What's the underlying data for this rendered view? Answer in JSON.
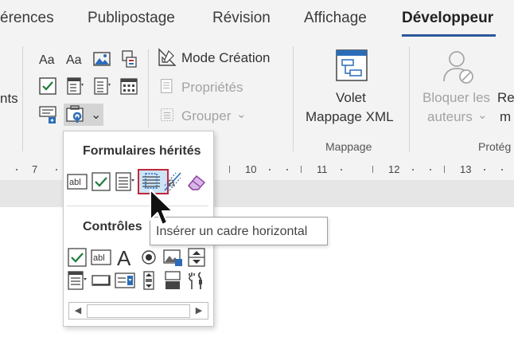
{
  "tabs": [
    {
      "label": "érences"
    },
    {
      "label": "Publipostage"
    },
    {
      "label": "Révision"
    },
    {
      "label": "Affichage"
    },
    {
      "label": "Développeur",
      "active": true
    }
  ],
  "ribbon": {
    "left_cut_label": "nts",
    "controls": {
      "mode_creation": "Mode Création",
      "proprietes": "Propriétés",
      "grouper": "Grouper",
      "grouper_arrow": "⌄",
      "gallery_arrow": "⌄"
    },
    "mappage": {
      "button_line1": "Volet",
      "button_line2": "Mappage XML",
      "group_label": "Mappage"
    },
    "protect": {
      "bloquer_line1": "Bloquer les",
      "bloquer_line2": "auteurs",
      "bloquer_arrow": "⌄",
      "res_line1": "Res",
      "res_line2": "m",
      "group_label": "Protég"
    }
  },
  "ruler": {
    "numbers": [
      "7",
      "10",
      "11",
      "12",
      "13"
    ]
  },
  "gallery": {
    "legacy_heading": "Formulaires hérités",
    "controls_heading": "Contrôles",
    "text_field_label": "abl",
    "text_field_label_2": "abl",
    "label_glyph": "A",
    "letter_a": "a",
    "scroll_left": "◀",
    "scroll_right": "▶"
  },
  "tooltip": {
    "text": "Insérer un cadre horizontal"
  },
  "colors": {
    "accent": "#2b579a",
    "highlight_border": "#c0283b",
    "check_green": "#1f7a3c",
    "icon_blue": "#2b6cb8"
  }
}
